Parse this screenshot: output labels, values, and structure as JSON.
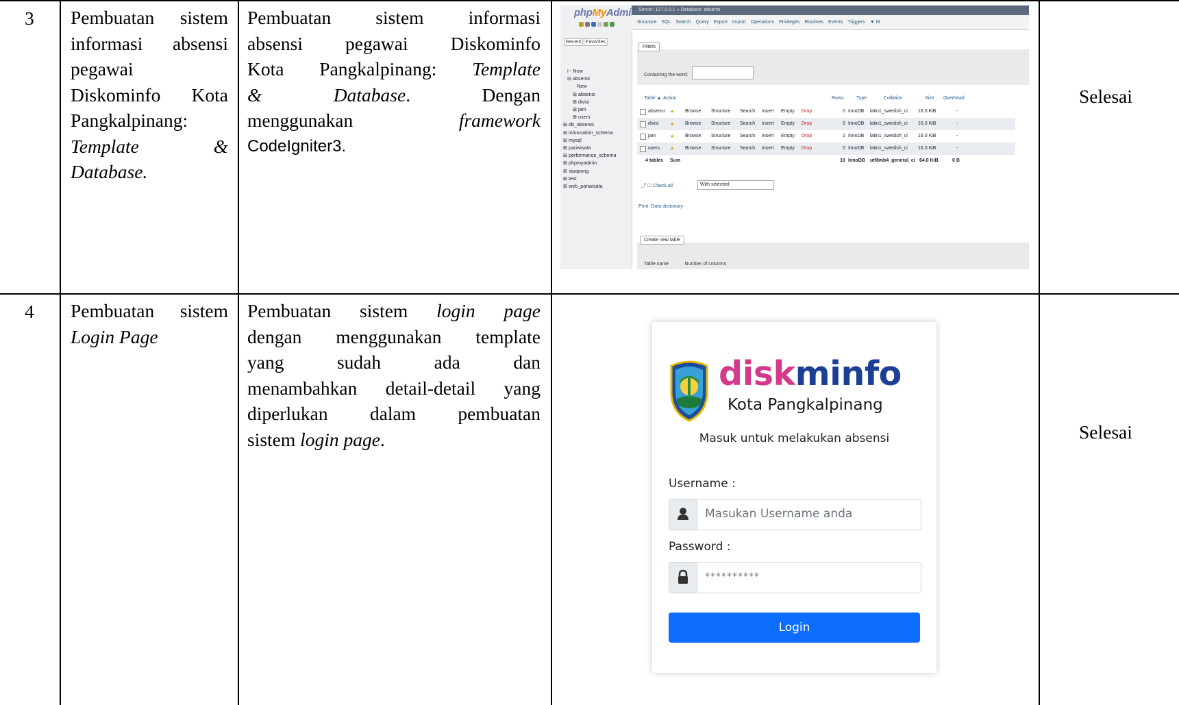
{
  "rows": [
    {
      "number": "3",
      "task_lines": [
        "Pembuatan sistem",
        "informasi absensi",
        "pegawai",
        "Diskominfo Kota",
        "Pangkalpinang:"
      ],
      "task_line6_a": "Template",
      "task_line6_b": "&",
      "task_line7": "Database.",
      "desc_l1": [
        "Pembuatan",
        "sistem",
        "informasi"
      ],
      "desc_l2": [
        "absensi",
        "pegawai",
        "Diskominfo"
      ],
      "desc_l3_a": "Kota Pangkalpinang:",
      "desc_l3_b": "Template",
      "desc_l4_a": "&",
      "desc_l4_b": "Database",
      "desc_l4_c": ".",
      "desc_l4_d": "Dengan",
      "desc_l5_a": "menggunakan",
      "desc_l5_b": "framework",
      "desc_l6": "CodeIgniter3.",
      "status": "Selesai"
    },
    {
      "number": "4",
      "task_line1": "Pembuatan sistem",
      "task_line2": "Login Page",
      "desc_l1_a": "Pembuatan sistem",
      "desc_l1_b": "login page",
      "desc_l2": "dengan menggunakan template",
      "desc_l3": [
        "yang",
        "sudah",
        "ada",
        "dan"
      ],
      "desc_l4": "menambahkan detail-detail yang",
      "desc_l5": [
        "diperlukan",
        "dalam",
        "pembuatan"
      ],
      "desc_l6_a": "sistem",
      "desc_l6_b": "login page",
      "desc_l6_c": ".",
      "status": "Selesai"
    }
  ],
  "phpmyadmin": {
    "logo_php": "php",
    "logo_my": "My",
    "logo_admin": "Admin",
    "topbar": "Server: 127.0.0.1 » Database: absensi",
    "side_tabs": [
      "Recent",
      "Favorites"
    ],
    "tree": [
      {
        "label": "New",
        "level": 1
      },
      {
        "label": "absensi",
        "level": 1
      },
      {
        "label": "New",
        "level": 3
      },
      {
        "label": "absensi",
        "level": 2
      },
      {
        "label": "divisi",
        "level": 2
      },
      {
        "label": "jam",
        "level": 2
      },
      {
        "label": "users",
        "level": 2
      },
      {
        "label": "db_absensi",
        "level": 1
      },
      {
        "label": "information_schema",
        "level": 1
      },
      {
        "label": "mysql",
        "level": 1
      },
      {
        "label": "pariwisata",
        "level": 1
      },
      {
        "label": "performance_schema",
        "level": 1
      },
      {
        "label": "phpmyadmin",
        "level": 1
      },
      {
        "label": "sipapong",
        "level": 1
      },
      {
        "label": "test",
        "level": 1
      },
      {
        "label": "web_pariwisata",
        "level": 1
      }
    ],
    "tabs": [
      "Structure",
      "SQL",
      "Search",
      "Query",
      "Export",
      "Import",
      "Operations",
      "Privileges",
      "Routines",
      "Events",
      "Triggers",
      "▼ M"
    ],
    "filters_label": "Filters",
    "filter_text": "Containing the word:",
    "headers": {
      "table": "Table ▲",
      "action": "Action",
      "rows": "Rows",
      "type": "Type",
      "collation": "Collation",
      "size": "Size",
      "overhead": "Overhead"
    },
    "action_words": {
      "browse": "Browse",
      "structure": "Structure",
      "search": "Search",
      "insert": "Insert",
      "empty": "Empty",
      "drop": "Drop"
    },
    "tables": [
      {
        "name": "absensi",
        "rows": "0",
        "type": "InnoDB",
        "collation": "latin1_swedish_ci",
        "size": "16.0 KiB",
        "overhead": "-"
      },
      {
        "name": "divisi",
        "rows": "5",
        "type": "InnoDB",
        "collation": "latin1_swedish_ci",
        "size": "16.0 KiB",
        "overhead": "-"
      },
      {
        "name": "jam",
        "rows": "2",
        "type": "InnoDB",
        "collation": "latin1_swedish_ci",
        "size": "16.0 KiB",
        "overhead": "-"
      },
      {
        "name": "users",
        "rows": "5",
        "type": "InnoDB",
        "collation": "latin1_swedish_ci",
        "size": "16.0 KiB",
        "overhead": "-"
      }
    ],
    "summary": {
      "tables": "4 tables",
      "sum": "Sum",
      "rows": "10",
      "type": "InnoDB",
      "collation": "utf8mb4_general_ci",
      "size": "64.0 KiB",
      "overhead": "0 B"
    },
    "check_all": "Check all",
    "with_selected": "With selected:",
    "print": "Print",
    "data_dictionary": "Data dictionary",
    "create_table": "Create new table",
    "table_name": "Table name",
    "number_of_columns": "Number of columns"
  },
  "login": {
    "logo_dis": "disk",
    "logo_rest": "minfo",
    "subtitle": "Kota Pangkalpinang",
    "message": "Masuk untuk melakukan absensi",
    "username_label": "Username :",
    "username_placeholder": "Masukan Username anda",
    "password_label": "Password :",
    "password_value": "**********",
    "button": "Login",
    "colors": {
      "primary": "#0d6efd",
      "logo_blue": "#1b3f94",
      "logo_pink": "#d43a8a"
    }
  }
}
